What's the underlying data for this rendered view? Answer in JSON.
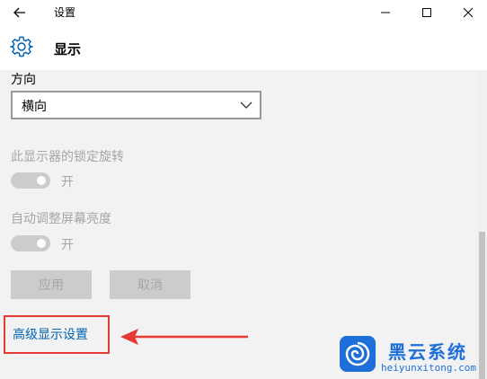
{
  "window": {
    "title": "设置",
    "controls": {
      "minimize": "minimize-icon",
      "maximize": "maximize-icon",
      "close": "close-icon"
    }
  },
  "header": {
    "icon": "gear-icon",
    "title": "显示"
  },
  "orientation": {
    "label": "方向",
    "selected": "横向"
  },
  "rotation_lock": {
    "label": "此显示器的锁定旋转",
    "state": "开"
  },
  "auto_brightness": {
    "label": "自动调整屏幕亮度",
    "state": "开"
  },
  "buttons": {
    "apply": "应用",
    "cancel": "取消"
  },
  "advanced_link": "高级显示设置",
  "watermark": {
    "name": "黑云系统",
    "url": "heiyunxitong.com"
  },
  "colors": {
    "link": "#0063b1",
    "highlight_box": "#e53935",
    "disabled_text": "#a6a6a6",
    "content_bg": "#f2f2f2",
    "watermark_blue": "#1e6fd9"
  }
}
